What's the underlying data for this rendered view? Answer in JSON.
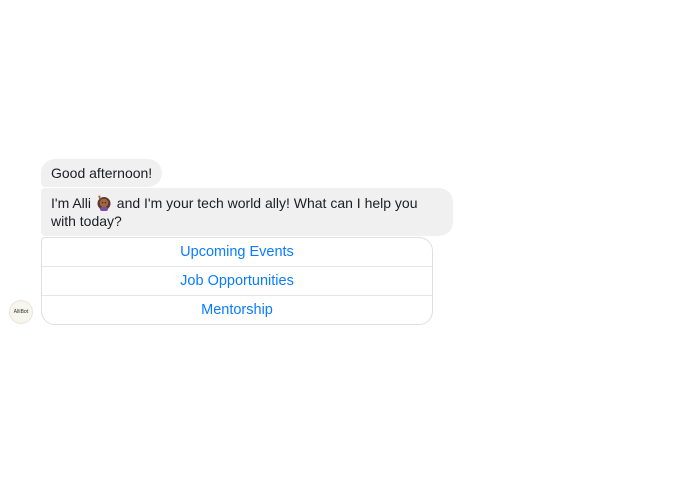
{
  "messages": {
    "greeting": "Good afternoon!",
    "intro_before_emoji": "I'm Alli ",
    "intro_emoji_icon": "woman-raising-hand-emoji",
    "intro_after_emoji": " and I'm your tech world ally! What can I help you with today?"
  },
  "quick_replies": [
    {
      "label": "Upcoming Events"
    },
    {
      "label": "Job Opportunities"
    },
    {
      "label": "Mentorship"
    }
  ],
  "bot": {
    "avatar_label": "AlliBot"
  },
  "colors": {
    "bubble_bg": "#f0f0f0",
    "link_blue": "#0a7cff",
    "border": "#dddfe2"
  }
}
